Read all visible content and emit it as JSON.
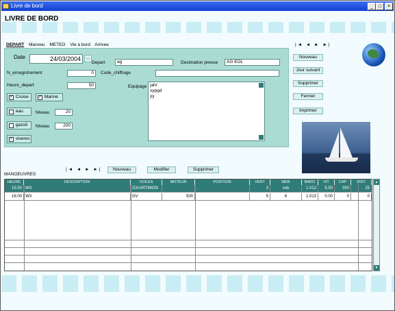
{
  "window": {
    "title": "Livre de bord",
    "min": "_",
    "max": "□",
    "close": "×"
  },
  "app_title": "LIVRE DE BORD",
  "tabs": [
    "DEPART",
    "Manoeu",
    "METEO",
    "Vie a bord",
    "Arrivee"
  ],
  "form": {
    "date_label": "Date",
    "date_value": "24/03/2004",
    "cal_btn": "...",
    "depart_label": "Depart",
    "depart_value": "ag",
    "dest_label": "Destination prevue",
    "dest_value": "AG  EOL",
    "num_label": "N_enregistrement",
    "num_value": "0",
    "code_label": "Code_chiffrage",
    "code_value": "",
    "heure_label": "Heure_depart",
    "heure_value": "50",
    "equipage_label": "Equipage",
    "equipage_value": [
      "jahr",
      "sypgd",
      "yy"
    ],
    "niveau1_label": "Niveau",
    "niveau1_value": "20",
    "niveau2_label": "Niveau",
    "niveau2_value": "200",
    "checks": [
      {
        "label": "Cruise",
        "checked": true
      },
      {
        "label": "Marine",
        "checked": true
      },
      {
        "label": "eau",
        "checked": false
      },
      {
        "label": "gazoil",
        "checked": false
      },
      {
        "label": "viveres",
        "checked": true
      }
    ]
  },
  "side": {
    "nav": "|◄ ◄ ► ►|",
    "buttons": [
      "Nouveau",
      "Jour suivant",
      "Supprimer",
      "Fermer",
      "Imprimer"
    ]
  },
  "grid_toolbar": {
    "nav": "|◄ ◄ ► ►|",
    "nouveau": "Nouveau",
    "modifier": "Modifier",
    "supprimer": "Supprimer"
  },
  "grid": {
    "title": "MANOEUVRES",
    "headers": [
      "HEURE",
      "DESCRIPTION",
      "VOILES",
      "MOTEUR",
      "POSITION",
      "VENT",
      "MER",
      "BARO",
      "VIT",
      "CAP",
      "DIST"
    ],
    "rows": [
      [
        "15:50",
        "WX",
        "GX/ARTIMON",
        "",
        "",
        "3",
        "sob",
        "1.012",
        "5.50",
        "350",
        "25"
      ],
      [
        "16:00",
        "WX",
        "GV",
        "500",
        "",
        "5",
        "6",
        "1.013",
        "0.00",
        "0",
        "0"
      ]
    ]
  }
}
